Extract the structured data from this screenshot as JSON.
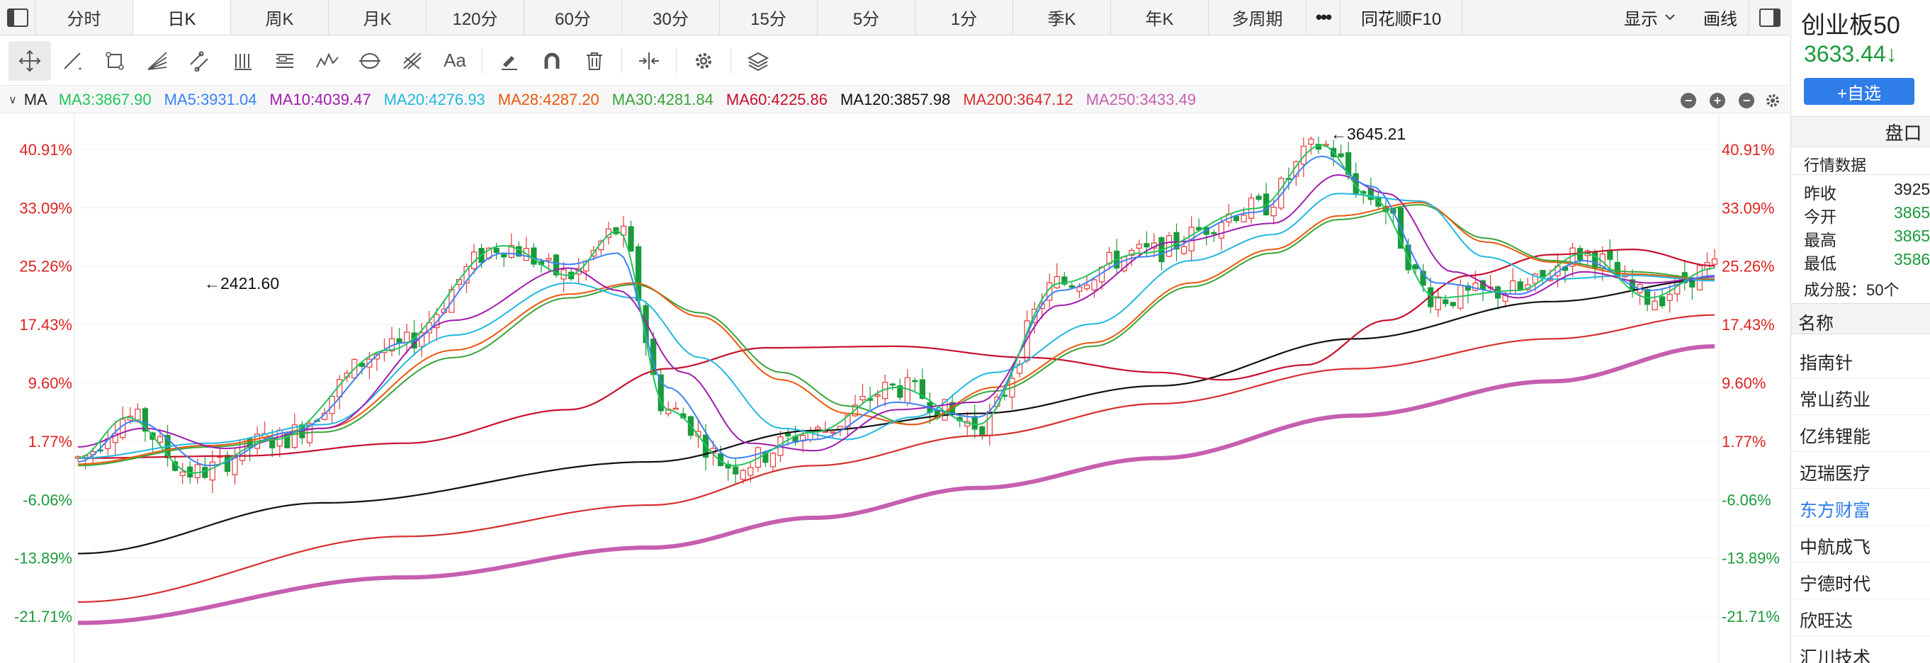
{
  "timeframes": {
    "tabs": [
      "分时",
      "日K",
      "周K",
      "月K",
      "120分",
      "60分",
      "30分",
      "15分",
      "5分",
      "1分",
      "季K",
      "年K",
      "多周期"
    ],
    "active": "日K",
    "f10": "同花顺F10",
    "display": "显示",
    "draw": "画线"
  },
  "toolbar": {
    "tools": [
      "crosshair-move",
      "line",
      "rectangle",
      "fan",
      "channel",
      "parallel-lines",
      "fibonacci",
      "wave",
      "cycle",
      "gann",
      "text",
      "pen",
      "magnet",
      "trash",
      "measure",
      "settings",
      "layers"
    ],
    "text_tool_label": "Aa"
  },
  "ma_bar": {
    "name": "MA",
    "items": [
      {
        "label": "MA3:3867.90",
        "color": "#21c55d"
      },
      {
        "label": "MA5:3931.04",
        "color": "#3b82f6"
      },
      {
        "label": "MA10:4039.47",
        "color": "#a21caf"
      },
      {
        "label": "MA20:4276.93",
        "color": "#22b8e0"
      },
      {
        "label": "MA28:4287.20",
        "color": "#ea580c"
      },
      {
        "label": "MA30:4281.84",
        "color": "#3aa33a"
      },
      {
        "label": "MA60:4225.86",
        "color": "#c8102e"
      },
      {
        "label": "MA120:3857.98",
        "color": "#111111"
      },
      {
        "label": "MA200:3647.12",
        "color": "#d62f2f"
      },
      {
        "label": "MA250:3433.49",
        "color": "#c65fb0"
      }
    ]
  },
  "chart_data": {
    "type": "line",
    "y_axis_ticks": [
      "40.91%",
      "33.09%",
      "25.26%",
      "17.43%",
      "9.60%",
      "1.77%",
      "-6.06%",
      "-13.89%",
      "-21.71%"
    ],
    "y_tick_colors": [
      "#d22",
      "#d22",
      "#d22",
      "#d22",
      "#d22",
      "#d22",
      "#1a9a3c",
      "#1a9a3c",
      "#1a9a3c"
    ],
    "ylim": [
      -25,
      45
    ],
    "annotations": [
      {
        "label": "←3645.21",
        "kind": "high"
      },
      {
        "label": "←2421.60",
        "kind": "low"
      }
    ],
    "candles": {
      "up_color": "#e23b3b",
      "down_color": "#1a9a3c",
      "count": 220
    },
    "ma_lines": [
      {
        "name": "MA120",
        "color": "#111111",
        "width": 2.2,
        "points": [
          [
            0,
            -13.3
          ],
          [
            0.15,
            -6.5
          ],
          [
            0.35,
            -1
          ],
          [
            0.45,
            3.2
          ],
          [
            0.55,
            5.5
          ],
          [
            0.66,
            9.2
          ],
          [
            0.78,
            15.5
          ],
          [
            0.9,
            20.5
          ],
          [
            1,
            23.5
          ]
        ]
      },
      {
        "name": "MA200",
        "color": "#d62f2f",
        "width": 2.2,
        "points": [
          [
            0,
            -19.8
          ],
          [
            0.2,
            -11
          ],
          [
            0.35,
            -6.8
          ],
          [
            0.45,
            -1.5
          ],
          [
            0.55,
            2.5
          ],
          [
            0.66,
            6.8
          ],
          [
            0.78,
            11.5
          ],
          [
            0.9,
            15.5
          ],
          [
            1,
            18.7
          ]
        ]
      },
      {
        "name": "MA250",
        "color": "#c65fb0",
        "width": 6,
        "points": [
          [
            0,
            -22.6
          ],
          [
            0.2,
            -16.5
          ],
          [
            0.35,
            -12.5
          ],
          [
            0.45,
            -8.5
          ],
          [
            0.55,
            -4.5
          ],
          [
            0.66,
            -0.5
          ],
          [
            0.78,
            5.2
          ],
          [
            0.9,
            9.8
          ],
          [
            1,
            14.5
          ]
        ]
      },
      {
        "name": "MA60",
        "color": "#c8102e",
        "width": 2.2,
        "points": [
          [
            0,
            -0.5
          ],
          [
            0.1,
            -0.2
          ],
          [
            0.2,
            1.5
          ],
          [
            0.3,
            6
          ],
          [
            0.36,
            11.5
          ],
          [
            0.42,
            14.3
          ],
          [
            0.5,
            14.5
          ],
          [
            0.58,
            13
          ],
          [
            0.66,
            11
          ],
          [
            0.7,
            10
          ],
          [
            0.75,
            12
          ],
          [
            0.8,
            18
          ],
          [
            0.85,
            24
          ],
          [
            0.9,
            26.8
          ],
          [
            0.95,
            27.5
          ],
          [
            1,
            25.3
          ]
        ]
      },
      {
        "name": "MA30",
        "color": "#3aa33a",
        "width": 2,
        "points": [
          [
            0,
            -1.5
          ],
          [
            0.08,
            1
          ],
          [
            0.15,
            3
          ],
          [
            0.23,
            13
          ],
          [
            0.3,
            21
          ],
          [
            0.34,
            22.8
          ],
          [
            0.38,
            19
          ],
          [
            0.43,
            11
          ],
          [
            0.47,
            6.5
          ],
          [
            0.51,
            4
          ],
          [
            0.56,
            8.5
          ],
          [
            0.62,
            14.5
          ],
          [
            0.68,
            22.5
          ],
          [
            0.73,
            27
          ],
          [
            0.77,
            31.5
          ],
          [
            0.82,
            33.5
          ],
          [
            0.86,
            29
          ],
          [
            0.9,
            26
          ],
          [
            0.95,
            24.5
          ],
          [
            1,
            23.5
          ]
        ]
      },
      {
        "name": "MA28",
        "color": "#ea580c",
        "width": 2,
        "points": [
          [
            0,
            -1.3
          ],
          [
            0.08,
            1.2
          ],
          [
            0.15,
            3.5
          ],
          [
            0.23,
            14
          ],
          [
            0.3,
            21.5
          ],
          [
            0.34,
            23
          ],
          [
            0.38,
            18.5
          ],
          [
            0.43,
            10
          ],
          [
            0.47,
            5.5
          ],
          [
            0.51,
            4
          ],
          [
            0.56,
            9
          ],
          [
            0.62,
            15
          ],
          [
            0.68,
            23
          ],
          [
            0.73,
            27.5
          ],
          [
            0.77,
            32
          ],
          [
            0.82,
            33.8
          ],
          [
            0.86,
            28.5
          ],
          [
            0.9,
            25.8
          ],
          [
            0.95,
            24.2
          ],
          [
            1,
            23.4
          ]
        ]
      },
      {
        "name": "MA20",
        "color": "#22b8e0",
        "width": 2,
        "points": [
          [
            0,
            -0.5
          ],
          [
            0.08,
            1.5
          ],
          [
            0.15,
            4
          ],
          [
            0.23,
            16
          ],
          [
            0.3,
            23
          ],
          [
            0.34,
            21
          ],
          [
            0.38,
            13
          ],
          [
            0.43,
            3.5
          ],
          [
            0.47,
            2
          ],
          [
            0.51,
            5
          ],
          [
            0.56,
            11
          ],
          [
            0.62,
            17.5
          ],
          [
            0.68,
            26
          ],
          [
            0.73,
            29.5
          ],
          [
            0.77,
            35
          ],
          [
            0.82,
            34
          ],
          [
            0.86,
            26.5
          ],
          [
            0.9,
            23.5
          ],
          [
            0.95,
            24
          ],
          [
            1,
            23.3
          ]
        ]
      },
      {
        "name": "MA10",
        "color": "#a21caf",
        "width": 2,
        "points": [
          [
            0,
            1
          ],
          [
            0.04,
            3.5
          ],
          [
            0.09,
            0.8
          ],
          [
            0.15,
            3.5
          ],
          [
            0.23,
            18
          ],
          [
            0.3,
            25
          ],
          [
            0.33,
            22
          ],
          [
            0.37,
            11
          ],
          [
            0.41,
            1.5
          ],
          [
            0.45,
            0.5
          ],
          [
            0.5,
            6
          ],
          [
            0.55,
            7
          ],
          [
            0.6,
            20
          ],
          [
            0.67,
            28.5
          ],
          [
            0.73,
            31
          ],
          [
            0.77,
            37.5
          ],
          [
            0.8,
            35
          ],
          [
            0.84,
            24.5
          ],
          [
            0.88,
            21
          ],
          [
            0.92,
            24.5
          ],
          [
            0.96,
            23
          ],
          [
            1,
            23.8
          ]
        ]
      },
      {
        "name": "MA5",
        "color": "#3b82f6",
        "width": 2,
        "points": [
          [
            0,
            -1
          ],
          [
            0.035,
            4.5
          ],
          [
            0.08,
            -1.5
          ],
          [
            0.13,
            3
          ],
          [
            0.2,
            15
          ],
          [
            0.26,
            27
          ],
          [
            0.3,
            25.5
          ],
          [
            0.33,
            27
          ],
          [
            0.36,
            9
          ],
          [
            0.4,
            -0.5
          ],
          [
            0.45,
            2
          ],
          [
            0.5,
            7
          ],
          [
            0.55,
            5
          ],
          [
            0.6,
            22
          ],
          [
            0.65,
            26.5
          ],
          [
            0.72,
            32.5
          ],
          [
            0.76,
            40
          ],
          [
            0.79,
            36
          ],
          [
            0.83,
            23
          ],
          [
            0.88,
            21.5
          ],
          [
            0.92,
            26
          ],
          [
            0.96,
            22
          ],
          [
            1,
            24
          ]
        ]
      },
      {
        "name": "MA3",
        "color": "#21c55d",
        "width": 2,
        "points": [
          [
            0,
            -0.5
          ],
          [
            0.03,
            5
          ],
          [
            0.07,
            -2.5
          ],
          [
            0.12,
            2
          ],
          [
            0.19,
            14
          ],
          [
            0.26,
            28
          ],
          [
            0.3,
            24
          ],
          [
            0.33,
            30
          ],
          [
            0.36,
            6
          ],
          [
            0.4,
            -1.5
          ],
          [
            0.45,
            3
          ],
          [
            0.5,
            9
          ],
          [
            0.55,
            4
          ],
          [
            0.6,
            23
          ],
          [
            0.65,
            27
          ],
          [
            0.72,
            33
          ],
          [
            0.76,
            41.5
          ],
          [
            0.79,
            34.5
          ],
          [
            0.83,
            21
          ],
          [
            0.88,
            22
          ],
          [
            0.92,
            27
          ],
          [
            0.96,
            21
          ],
          [
            1,
            25
          ]
        ]
      }
    ]
  },
  "right_panel": {
    "stock_name": "创业板50",
    "price": "3633.44↓",
    "add_button": "+自选",
    "tab": "盘口",
    "quote_title": "行情数据",
    "quotes": [
      {
        "label": "昨收",
        "value": "3925",
        "color": "#222"
      },
      {
        "label": "今开",
        "value": "3865",
        "color": "#1a9a3c"
      },
      {
        "label": "最高",
        "value": "3865",
        "color": "#1a9a3c"
      },
      {
        "label": "最低",
        "value": "3586",
        "color": "#1a9a3c"
      }
    ],
    "components_label": "成分股：50个",
    "components_header": "名称",
    "components": [
      {
        "name": "指南针",
        "color": "#222"
      },
      {
        "name": "常山药业",
        "color": "#222"
      },
      {
        "name": "亿纬锂能",
        "color": "#222"
      },
      {
        "name": "迈瑞医疗",
        "color": "#222"
      },
      {
        "name": "东方财富",
        "color": "#2f7de8"
      },
      {
        "name": "中航成飞",
        "color": "#222"
      },
      {
        "name": "宁德时代",
        "color": "#222"
      },
      {
        "name": "欣旺达",
        "color": "#222"
      },
      {
        "name": "汇川技术",
        "color": "#222"
      }
    ]
  }
}
